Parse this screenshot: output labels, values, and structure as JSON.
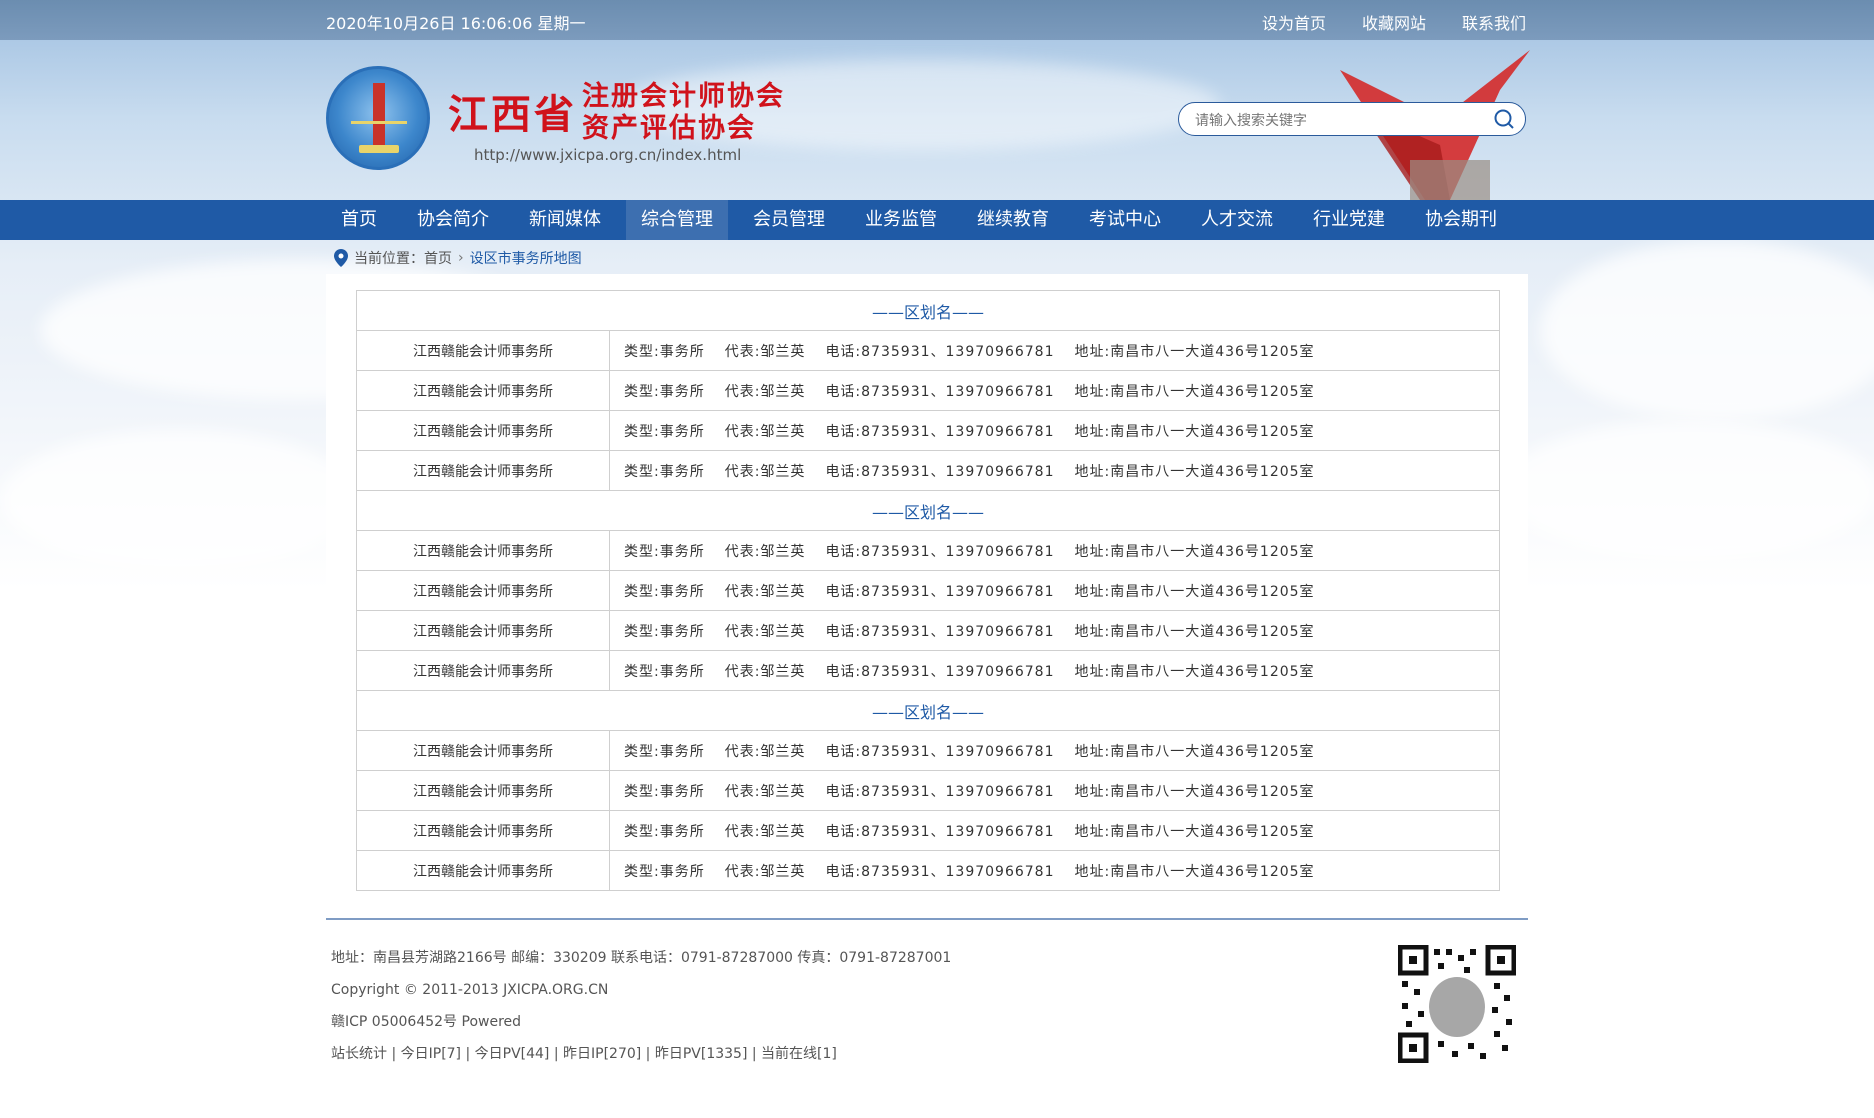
{
  "topbar": {
    "datetime": "2020年10月26日  16:06:06   星期一",
    "links": [
      "设为首页",
      "收藏网站",
      "联系我们"
    ]
  },
  "header": {
    "brand_main": "江西省",
    "brand_line1": "注册会计师协会",
    "brand_line2": "资产评估协会",
    "url": "http://www.jxicpa.org.cn/index.html",
    "search_placeholder": "请输入搜索关键字"
  },
  "nav": {
    "items": [
      "首页",
      "协会简介",
      "新闻媒体",
      "综合管理",
      "会员管理",
      "业务监管",
      "继续教育",
      "考试中心",
      "人才交流",
      "行业党建",
      "协会期刊"
    ],
    "active_index": 3
  },
  "breadcrumb": {
    "label": "当前位置：",
    "home": "首页",
    "current": "设区市事务所地图"
  },
  "groups": [
    {
      "region": "——区划名——",
      "rows": [
        {
          "name": "江西赣能会计师事务所",
          "type": "类型:事务所",
          "rep": "代表:邹兰英",
          "phone": "电话:8735931、13970966781",
          "address": "地址:南昌市八一大道436号1205室"
        },
        {
          "name": "江西赣能会计师事务所",
          "type": "类型:事务所",
          "rep": "代表:邹兰英",
          "phone": "电话:8735931、13970966781",
          "address": "地址:南昌市八一大道436号1205室"
        },
        {
          "name": "江西赣能会计师事务所",
          "type": "类型:事务所",
          "rep": "代表:邹兰英",
          "phone": "电话:8735931、13970966781",
          "address": "地址:南昌市八一大道436号1205室"
        },
        {
          "name": "江西赣能会计师事务所",
          "type": "类型:事务所",
          "rep": "代表:邹兰英",
          "phone": "电话:8735931、13970966781",
          "address": "地址:南昌市八一大道436号1205室"
        }
      ]
    },
    {
      "region": "——区划名——",
      "rows": [
        {
          "name": "江西赣能会计师事务所",
          "type": "类型:事务所",
          "rep": "代表:邹兰英",
          "phone": "电话:8735931、13970966781",
          "address": "地址:南昌市八一大道436号1205室"
        },
        {
          "name": "江西赣能会计师事务所",
          "type": "类型:事务所",
          "rep": "代表:邹兰英",
          "phone": "电话:8735931、13970966781",
          "address": "地址:南昌市八一大道436号1205室"
        },
        {
          "name": "江西赣能会计师事务所",
          "type": "类型:事务所",
          "rep": "代表:邹兰英",
          "phone": "电话:8735931、13970966781",
          "address": "地址:南昌市八一大道436号1205室"
        },
        {
          "name": "江西赣能会计师事务所",
          "type": "类型:事务所",
          "rep": "代表:邹兰英",
          "phone": "电话:8735931、13970966781",
          "address": "地址:南昌市八一大道436号1205室"
        }
      ]
    },
    {
      "region": "——区划名——",
      "rows": [
        {
          "name": "江西赣能会计师事务所",
          "type": "类型:事务所",
          "rep": "代表:邹兰英",
          "phone": "电话:8735931、13970966781",
          "address": "地址:南昌市八一大道436号1205室"
        },
        {
          "name": "江西赣能会计师事务所",
          "type": "类型:事务所",
          "rep": "代表:邹兰英",
          "phone": "电话:8735931、13970966781",
          "address": "地址:南昌市八一大道436号1205室"
        },
        {
          "name": "江西赣能会计师事务所",
          "type": "类型:事务所",
          "rep": "代表:邹兰英",
          "phone": "电话:8735931、13970966781",
          "address": "地址:南昌市八一大道436号1205室"
        },
        {
          "name": "江西赣能会计师事务所",
          "type": "类型:事务所",
          "rep": "代表:邹兰英",
          "phone": "电话:8735931、13970966781",
          "address": "地址:南昌市八一大道436号1205室"
        }
      ]
    }
  ],
  "footer": {
    "address": "地址：南昌县芳湖路2166号  邮编：330209  联系电话：0791-87287000  传真：0791-87287001",
    "copyright": "Copyright © 2011-2013 JXICPA.ORG.CN",
    "icp": "赣ICP 05006452号 Powered",
    "stats": "站长统计 | 今日IP[7] | 今日PV[44] | 昨日IP[270] | 昨日PV[1335] | 当前在线[1]"
  },
  "colors": {
    "nav_bg": "#1f5aa6",
    "nav_active": "#3d6fb0",
    "brand_red": "#d0121b",
    "link_blue": "#1f5aa6"
  }
}
